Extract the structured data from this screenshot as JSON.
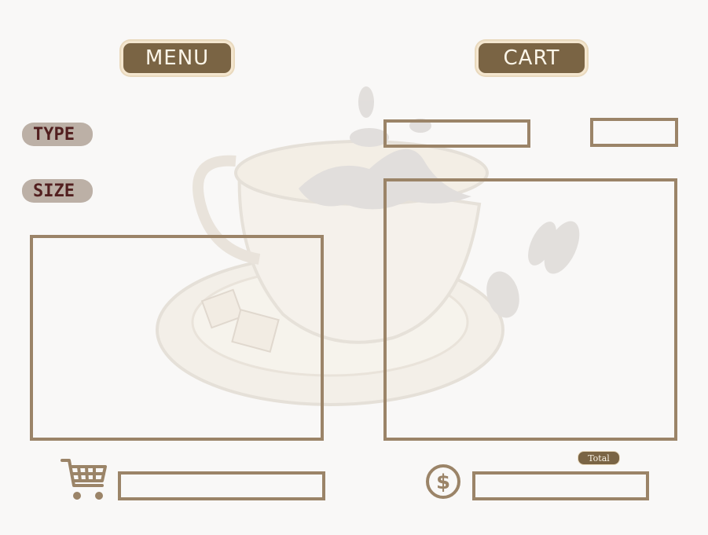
{
  "header": {
    "menu_label": "MENU",
    "cart_label": "CART"
  },
  "filters": {
    "type_label": "TYPE",
    "size_label": "SIZE"
  },
  "footer": {
    "total_label": "Total"
  },
  "icons": {
    "cart": "shopping-cart-icon",
    "dollar": "dollar-coin-icon"
  },
  "colors": {
    "background": "#f9f8f7",
    "button": "#7a6444",
    "frame": "#9b8468",
    "label_blob": "#b9ada2",
    "label_text": "#4a1414"
  }
}
